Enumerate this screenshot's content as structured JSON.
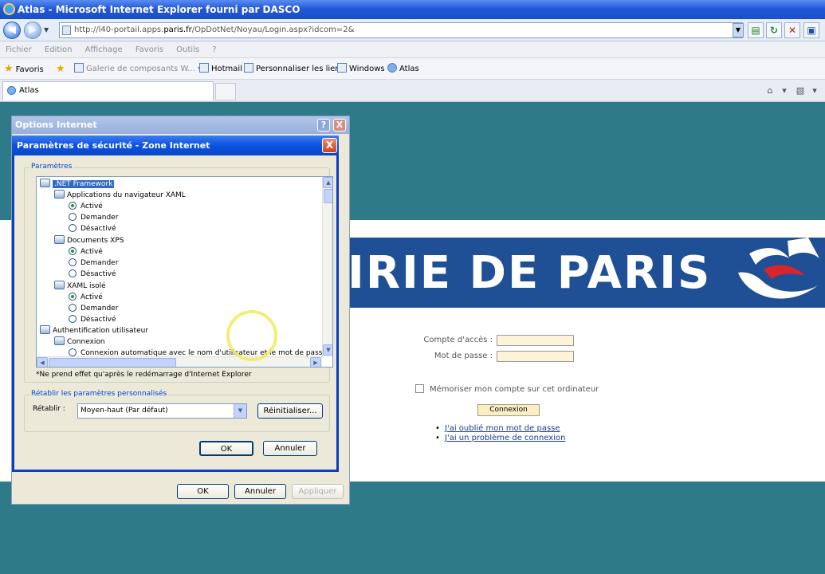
{
  "window": {
    "title": "Atlas - Microsoft Internet Explorer fourni par DASCO"
  },
  "navbar": {
    "address_prefix": "http://l40-portail.apps.",
    "address_domain": "paris.fr",
    "address_suffix": "/OpDotNet/Noyau/Login.aspx?idcom=2&"
  },
  "menubar": [
    "Fichier",
    "Edition",
    "Affichage",
    "Favoris",
    "Outils",
    "?"
  ],
  "favbar": {
    "favoris": "Favoris",
    "items": [
      "Galerie de composants W...",
      "Hotmail",
      "Personnaliser les liens",
      "Windows",
      "Atlas"
    ]
  },
  "tab": {
    "label": "Atlas"
  },
  "page": {
    "banner_text": "IRIE DE PARIS",
    "login_label": "Compte d'accès :",
    "password_label": "Mot de passe :",
    "remember_label": "Mémoriser mon compte sur cet ordinateur",
    "connect_button": "Connexion",
    "links": [
      "J'ai oublié mon mot de passe",
      "J'ai un problème de connexion"
    ],
    "colors": {
      "banner": "#1f4f94",
      "background": "#2f7a88"
    }
  },
  "options_dialog": {
    "title": "Options Internet",
    "help": "?",
    "close": "X",
    "ok": "OK",
    "cancel": "Annuler",
    "apply": "Appliquer"
  },
  "security_dialog": {
    "title": "Paramètres de sécurité - Zone Internet",
    "close": "X",
    "group_params": "Paramètres",
    "tree": [
      ".NET Framework",
      "Applications du navigateur XAML",
      "Activé",
      "Demander",
      "Désactivé",
      "Documents XPS",
      "Activé",
      "Demander",
      "Désactivé",
      "XAML isolé",
      "Activé",
      "Demander",
      "Désactivé",
      "Authentification utilisateur",
      "Connexion",
      "Connexion automatique avec le nom d'utilisateur et le mot de passe"
    ],
    "note": "*Ne prend effet qu'après le redémarrage d'Internet Explorer",
    "group_reset": "Rétablir les paramètres personnalisés",
    "reset_label": "Rétablir :",
    "reset_value": "Moyen-haut (Par défaut)",
    "reset_button": "Réinitialiser...",
    "ok": "OK",
    "cancel": "Annuler"
  }
}
